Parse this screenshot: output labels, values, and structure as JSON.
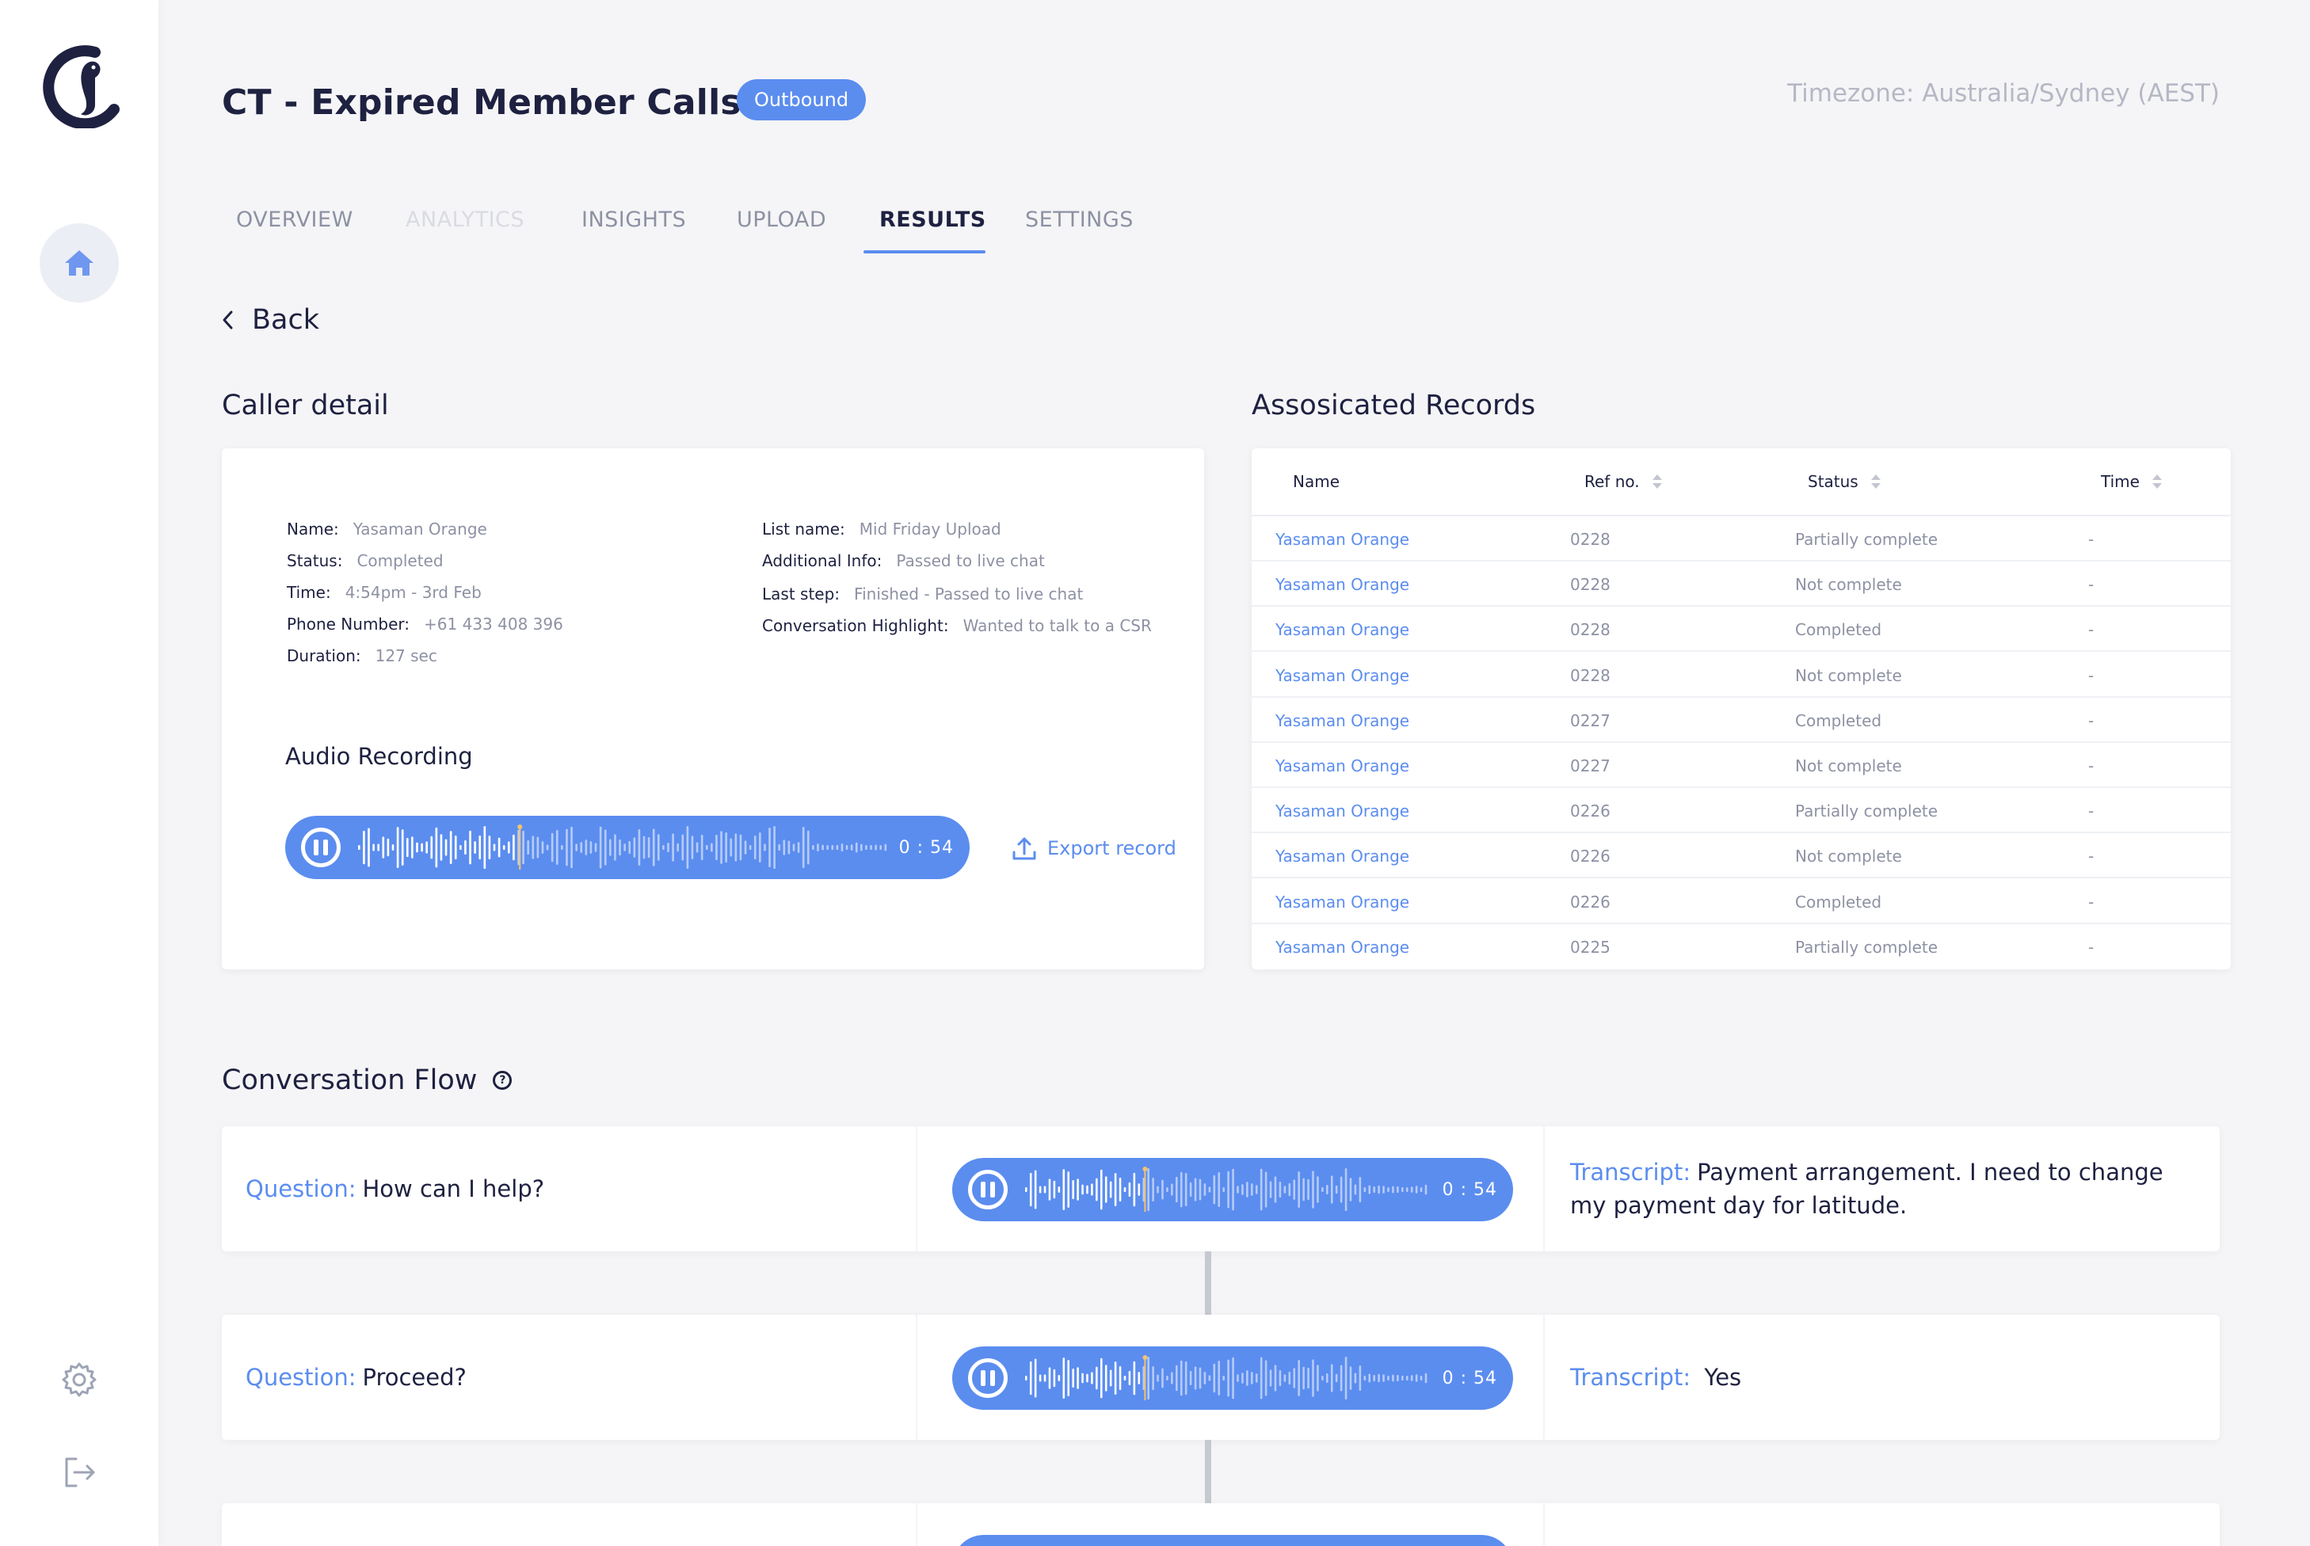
{
  "header": {
    "title": "CT - Expired Member Calls",
    "badge": "Outbound",
    "timezone": "Timezone: Australia/Sydney (AEST)"
  },
  "tabs": [
    {
      "label": "OVERVIEW",
      "state": "normal"
    },
    {
      "label": "ANALYTICS",
      "state": "disabled"
    },
    {
      "label": "INSIGHTS",
      "state": "normal"
    },
    {
      "label": "UPLOAD",
      "state": "normal"
    },
    {
      "label": "RESULTS",
      "state": "active"
    },
    {
      "label": "SETTINGS",
      "state": "normal"
    }
  ],
  "back_label": "Back",
  "caller": {
    "title": "Caller detail",
    "left": [
      {
        "k": "Name:",
        "v": "Yasaman Orange"
      },
      {
        "k": "Status:",
        "v": "Completed"
      },
      {
        "k": "Time:",
        "v": "4:54pm - 3rd Feb"
      },
      {
        "k": "Phone Number:",
        "v": "+61 433 408 396"
      },
      {
        "k": "Duration:",
        "v": "127 sec"
      }
    ],
    "right": [
      {
        "k": "List name:",
        "v": "Mid Friday Upload"
      },
      {
        "k": "Additional Info:",
        "v": "Passed to live chat"
      },
      {
        "k": "Last step:",
        "v": "Finished - Passed to live chat"
      },
      {
        "k": "Conversation Highlight:",
        "v": "Wanted to talk to a CSR"
      }
    ],
    "audio_title": "Audio Recording",
    "audio_time": "0 : 54",
    "export_label": "Export record"
  },
  "records": {
    "title": "Assosicated Records",
    "columns": [
      "Name",
      "Ref no.",
      "Status",
      "Time"
    ],
    "rows": [
      {
        "name": "Yasaman Orange",
        "ref": "0228",
        "status": "Partially complete",
        "time": "-"
      },
      {
        "name": "Yasaman Orange",
        "ref": "0228",
        "status": "Not complete",
        "time": "-"
      },
      {
        "name": "Yasaman Orange",
        "ref": "0228",
        "status": "Completed",
        "time": "-"
      },
      {
        "name": "Yasaman Orange",
        "ref": "0228",
        "status": "Not complete",
        "time": "-"
      },
      {
        "name": "Yasaman Orange",
        "ref": "0227",
        "status": "Completed",
        "time": "-"
      },
      {
        "name": "Yasaman Orange",
        "ref": "0227",
        "status": "Not complete",
        "time": "-"
      },
      {
        "name": "Yasaman Orange",
        "ref": "0226",
        "status": "Partially complete",
        "time": "-"
      },
      {
        "name": "Yasaman Orange",
        "ref": "0226",
        "status": "Not complete",
        "time": "-"
      },
      {
        "name": "Yasaman Orange",
        "ref": "0226",
        "status": "Completed",
        "time": "-"
      },
      {
        "name": "Yasaman Orange",
        "ref": "0225",
        "status": "Partially complete",
        "time": "-"
      }
    ]
  },
  "flow": {
    "title": "Conversation Flow",
    "help_glyph": "?",
    "question_label": "Question:",
    "transcript_label": "Transcript:",
    "items": [
      {
        "question": "How can I help?",
        "audio_time": "0 : 54",
        "transcript": "Payment arrangement.  I need to change my payment day for latitude."
      },
      {
        "question": "Proceed?",
        "audio_time": "0 : 54",
        "transcript": "Yes"
      }
    ]
  },
  "colors": {
    "accent": "#5b8def",
    "text": "#1e2140",
    "muted": "#8d91a3"
  }
}
